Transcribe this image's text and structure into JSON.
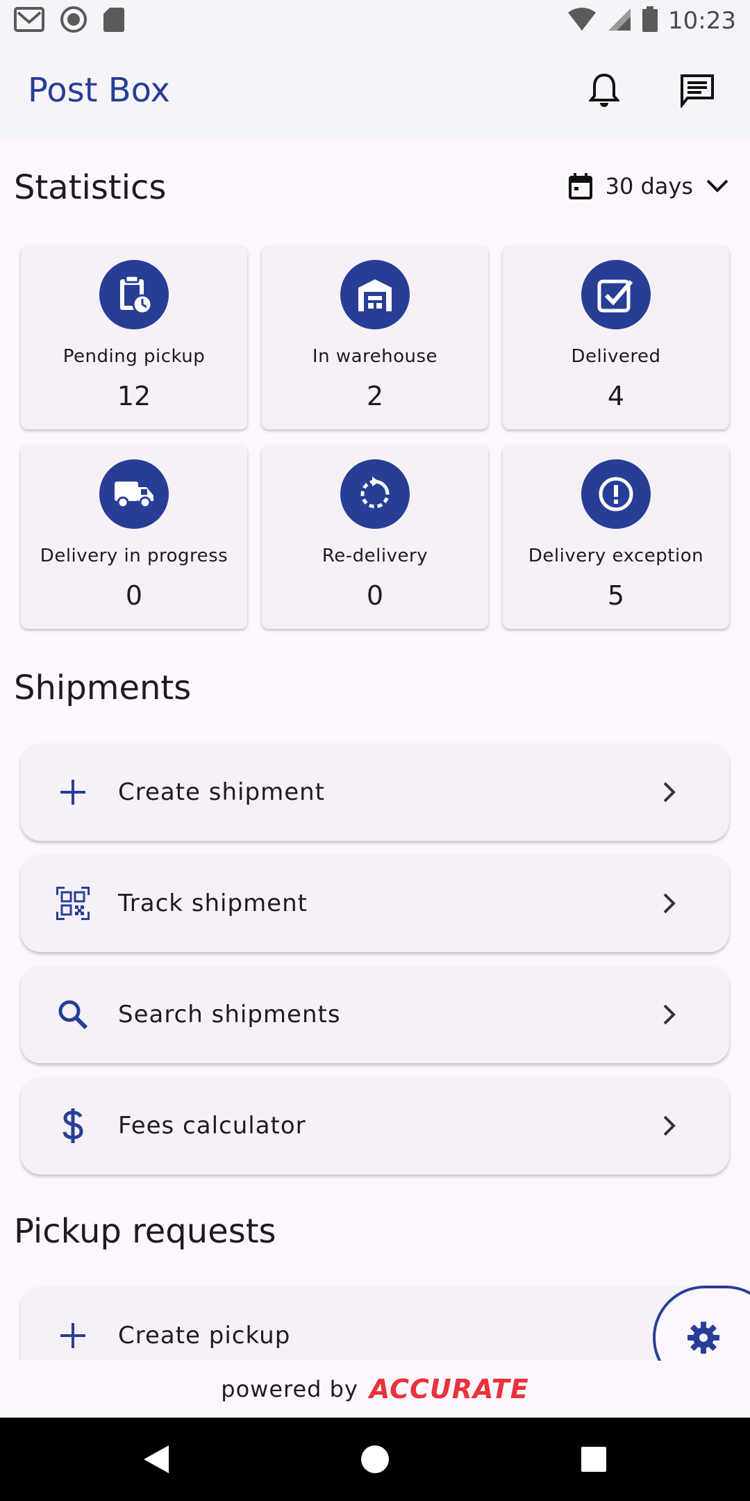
{
  "status_bar": {
    "time": "10:23"
  },
  "app_bar": {
    "title": "Post Box"
  },
  "statistics": {
    "title": "Statistics",
    "range": "30 days",
    "cards": [
      {
        "label": "Pending pickup",
        "value": "12",
        "icon": "clipboard-clock-icon"
      },
      {
        "label": "In warehouse",
        "value": "2",
        "icon": "warehouse-icon"
      },
      {
        "label": "Delivered",
        "value": "4",
        "icon": "checkbox-icon"
      },
      {
        "label": "Delivery in progress",
        "value": "0",
        "icon": "truck-icon"
      },
      {
        "label": "Re-delivery",
        "value": "0",
        "icon": "refresh-icon"
      },
      {
        "label": "Delivery exception",
        "value": "5",
        "icon": "exclamation-icon"
      }
    ]
  },
  "shipments": {
    "title": "Shipments",
    "items": [
      {
        "label": "Create shipment",
        "icon": "plus-icon"
      },
      {
        "label": "Track shipment",
        "icon": "qr-code-icon"
      },
      {
        "label": "Search shipments",
        "icon": "search-icon"
      },
      {
        "label": "Fees calculator",
        "icon": "dollar-icon"
      }
    ]
  },
  "pickup_requests": {
    "title": "Pickup requests",
    "items": [
      {
        "label": "Create pickup",
        "icon": "plus-icon"
      }
    ]
  },
  "footer": {
    "powered_by": "powered by",
    "brand": "ACCURATE"
  },
  "colors": {
    "primary": "#283e96",
    "brand_red": "#e8323c",
    "background": "#fdf7fd"
  }
}
